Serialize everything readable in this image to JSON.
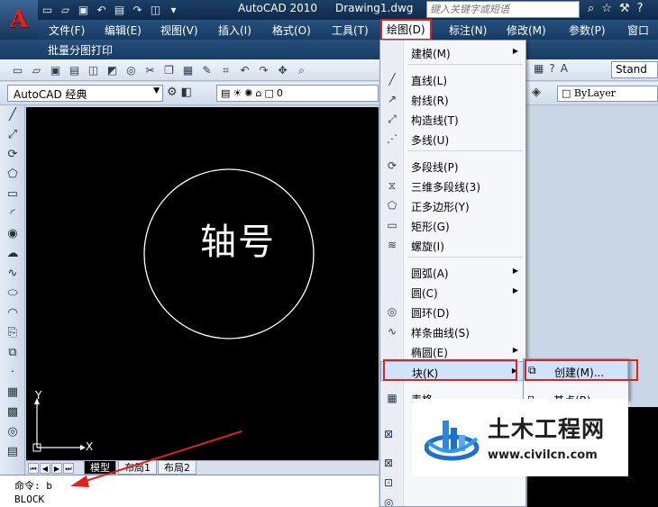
{
  "title_bar": {
    "app_title": "AutoCAD 2010",
    "doc_title": "Drawing1.dwg",
    "search_placeholder": "键入关键字或短语",
    "logo_letter": "A"
  },
  "menu_bar": {
    "items": [
      "文件(F)",
      "编辑(E)",
      "视图(V)",
      "插入(I)",
      "格式(O)",
      "工具(T)",
      "绘图(D)",
      "标注(N)",
      "修改(M)",
      "参数(P)",
      "窗口"
    ],
    "active": "绘图(D)",
    "row2": "批量分图打印"
  },
  "toolbar": {
    "workspace": "AutoCAD 经典",
    "layer_value": "0",
    "text_style": "Stand",
    "linetype": "ByLayer"
  },
  "draw_menu": {
    "items": [
      {
        "label": "建模(M)",
        "icon": "modeling-icon",
        "submenu": true
      },
      {
        "label": "直线(L)",
        "icon": "line-icon"
      },
      {
        "label": "射线(R)",
        "icon": "ray-icon"
      },
      {
        "label": "构造线(T)",
        "icon": "xline-icon"
      },
      {
        "label": "多线(U)",
        "icon": "mline-icon"
      },
      {
        "label": "多段线(P)",
        "icon": "polyline-icon"
      },
      {
        "label": "三维多段线(3)",
        "icon": "3dpoly-icon"
      },
      {
        "label": "正多边形(Y)",
        "icon": "polygon-icon"
      },
      {
        "label": "矩形(G)",
        "icon": "rectangle-icon"
      },
      {
        "label": "螺旋(I)",
        "icon": "helix-icon"
      },
      {
        "label": "圆弧(A)",
        "icon": "arc-icon",
        "submenu": true
      },
      {
        "label": "圆(C)",
        "icon": "circle-icon",
        "submenu": true
      },
      {
        "label": "圆环(D)",
        "icon": "donut-icon"
      },
      {
        "label": "样条曲线(S)",
        "icon": "spline-icon"
      },
      {
        "label": "椭圆(E)",
        "icon": "ellipse-icon",
        "submenu": true
      },
      {
        "label": "块(K)",
        "icon": "block-icon",
        "submenu": true
      },
      {
        "label": "表格...",
        "icon": "table-icon"
      }
    ]
  },
  "block_submenu": {
    "items": [
      {
        "label": "创建(M)..."
      },
      {
        "label": "基点(B)"
      }
    ]
  },
  "canvas": {
    "text": "轴号",
    "ucs_x": "X",
    "ucs_y": "Y"
  },
  "layout_tabs": [
    "模型",
    "布局1",
    "布局2"
  ],
  "command_line": {
    "line1": "命令: b",
    "line2": "BLOCK"
  },
  "watermark": {
    "title": "土木工程网",
    "url": "www.civilcn.com"
  },
  "colors": {
    "title_bar": "#0c2a4a",
    "highlight_box": "#e0221d",
    "menu_highlight": "#cfe3fb",
    "canvas": "#000000",
    "logo_red": "#e3231a",
    "watermark_blue": "#1e6fc9"
  }
}
